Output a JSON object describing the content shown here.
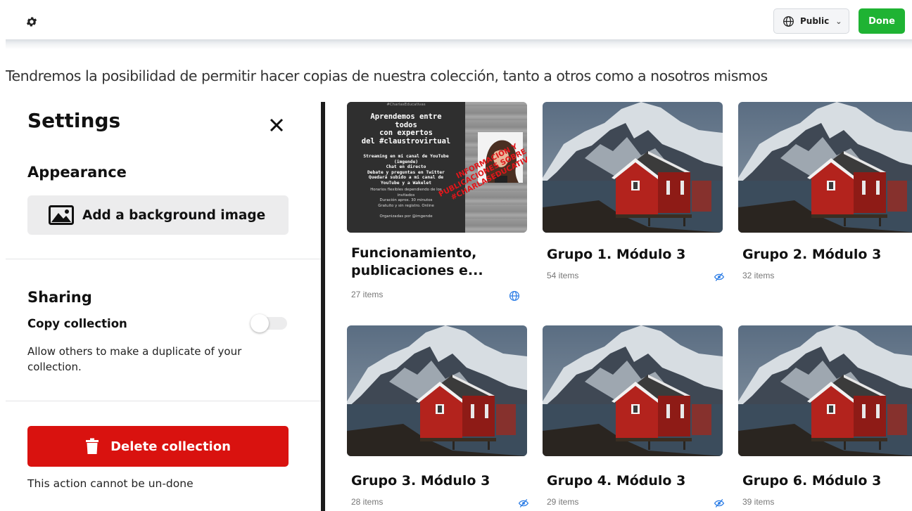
{
  "toolbar": {
    "settings_icon": "gear-icon",
    "visibility_label": "Public",
    "visibility_icon": "globe-icon",
    "done_label": "Done",
    "done_color": "#1fb333"
  },
  "caption": "Tendremos la posibilidad de permitir hacer copias de nuestra colección, tanto a otros como a nosotros mismos",
  "settings": {
    "title": "Settings",
    "appearance": {
      "heading": "Appearance",
      "background_button": "Add a background image"
    },
    "sharing": {
      "heading": "Sharing",
      "copy_label": "Copy collection",
      "copy_enabled": false,
      "copy_description": "Allow others to make a duplicate of your collection."
    },
    "delete": {
      "button": "Delete collection",
      "button_color": "#d9120f",
      "note": "This action cannot be un-done"
    }
  },
  "cards": [
    {
      "title_line1": "Funcionamiento,",
      "title_line2": "publicaciones e...",
      "count": "27 items",
      "visibility": "globe-icon"
    },
    {
      "title": "Grupo 1. Módulo 3",
      "count": "54 items",
      "visibility": "hidden-eye-icon"
    },
    {
      "title": "Grupo 2. Módulo 3",
      "count": "32 items",
      "visibility": "hidden-eye-icon"
    },
    {
      "title": "Grupo 3. Módulo 3",
      "count": "28 items",
      "visibility": "hidden-eye-icon"
    },
    {
      "title": "Grupo 4. Módulo 3",
      "count": "29 items",
      "visibility": "hidden-eye-icon"
    },
    {
      "title": "Grupo 6. Módulo 3",
      "count": "39 items",
      "visibility": "hidden-eye-icon"
    }
  ],
  "poster": {
    "tag": "#CharlasEducativas",
    "heading_lines": [
      "Aprendemos entre",
      "todos",
      "con expertos",
      "del #claustrovirtual"
    ],
    "body_lines": [
      "Streaming en mi canal de YouTube",
      "(imgende)",
      "Chat en directo",
      "Debate y preguntas en Twitter",
      "Quedará subido a mi canal de",
      "YouTube y a Wakelet"
    ],
    "small_lines": [
      "Horarios flexibles dependiendo de los",
      "invitados",
      "Duración aprox. 30 minutos",
      "Gratuito y sin registro. Online",
      "",
      "Organizadas por @imgende"
    ],
    "stamp_lines": [
      "INFORMACIÓN Y",
      "PUBLICACIONES SOBRE LAS",
      "#CHARLASEDUCATIVAS"
    ]
  }
}
